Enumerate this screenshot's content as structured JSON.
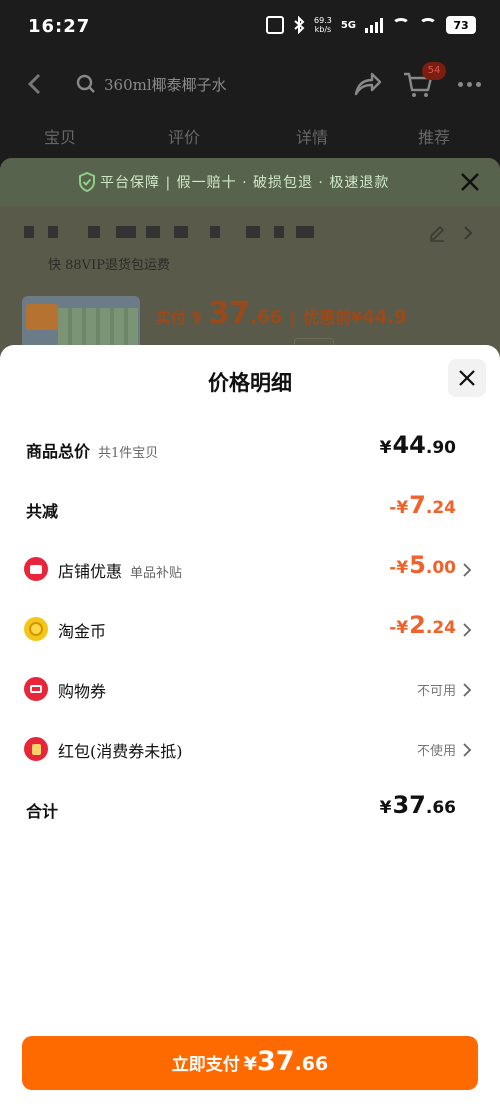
{
  "status_bar": {
    "time": "16:27",
    "net_speed_value": "69.3",
    "net_speed_unit": "kb/s",
    "network": "5G",
    "battery": "73"
  },
  "nav": {
    "search_text": "360ml椰泰椰子水",
    "cart_count": "54"
  },
  "tabs": [
    "宝贝",
    "评价",
    "详情",
    "推荐"
  ],
  "guarantee": {
    "text": "平台保障 | 假一赔十 · 破损包退 · 极速退款"
  },
  "product": {
    "shipping_line": "快                  88VIP退货包运费",
    "price": {
      "label": "实付",
      "currency": "¥",
      "integer": "37",
      "decimal": ".66",
      "separator": "|",
      "pre_label": "优惠前",
      "pre_currency": "¥",
      "pre_value": "44.9"
    }
  },
  "sheet": {
    "title": "价格明细",
    "rows": [
      {
        "label": "商品总价",
        "sub": "共1件宝贝",
        "currency": "¥",
        "integer": "44",
        "decimal": ".90"
      },
      {
        "label": "共减",
        "currency": "-¥",
        "integer": "7",
        "decimal": ".24"
      },
      {
        "label": "店铺优惠",
        "sub": "单品补贴",
        "icon": "shop-discount-icon",
        "currency": "-¥",
        "integer": "5",
        "decimal": ".00"
      },
      {
        "label": "淘金币",
        "icon": "tao-coin-icon",
        "currency": "-¥",
        "integer": "2",
        "decimal": ".24"
      },
      {
        "label": "购物券",
        "icon": "shopping-voucher-icon",
        "value_text": "不可用"
      },
      {
        "label": "红包(消费券未抵)",
        "icon": "red-envelope-icon",
        "value_text": "不使用"
      },
      {
        "label": "合计",
        "currency": "¥",
        "integer": "37",
        "decimal": ".66"
      }
    ],
    "pay_button": {
      "label": "立即支付",
      "currency": "¥",
      "integer": "37",
      "decimal": ".66"
    }
  },
  "colors": {
    "accent_orange": "#ff6a00",
    "discount_orange": "#f0622b",
    "icon_red": "#e8253a",
    "icon_gold": "#f5c61a"
  }
}
